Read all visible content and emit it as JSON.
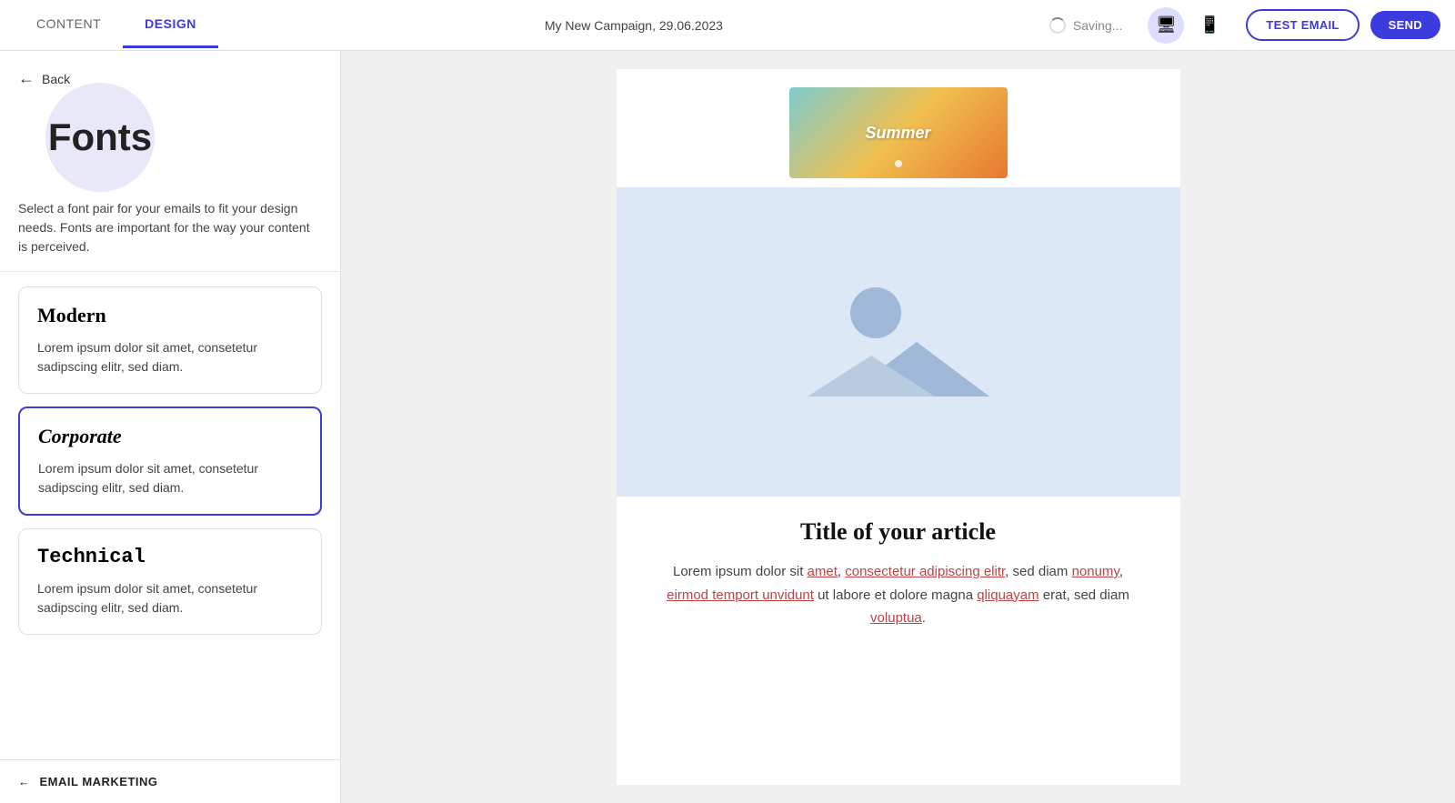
{
  "topbar": {
    "tab_content": "CONTENT",
    "tab_design": "DESIGN",
    "campaign_name": "My New Campaign, 29.06.2023",
    "saving_text": "Saving...",
    "test_email_label": "TEST EMAIL",
    "send_label": "SEND"
  },
  "sidebar": {
    "back_label": "Back",
    "title": "Fonts",
    "description": "Select a font pair for your emails to fit your design needs. Fonts are important for the way your content is perceived.",
    "font_cards": [
      {
        "id": "modern",
        "title": "Modern",
        "title_class": "modern",
        "body": "Lorem ipsum dolor sit amet, consetetur sadipscing elitr, sed diam.",
        "selected": false
      },
      {
        "id": "corporate",
        "title": "Corporate",
        "title_class": "corporate",
        "body": "Lorem ipsum dolor sit amet, consetetur sadipscing elitr, sed diam.",
        "selected": true
      },
      {
        "id": "technical",
        "title": "Technical",
        "title_class": "technical",
        "body": "Lorem ipsum dolor sit amet, consetetur sadipscing elitr, sed diam.",
        "selected": false
      }
    ],
    "bottom_label": "EMAIL MARKETING"
  },
  "preview": {
    "summer_label": "Summer",
    "article_title": "Title of your article",
    "article_body_1": "Lorem ipsum dolor sit amet, ",
    "article_body_link1": "amet",
    "article_body_2": ", consectetur adipiscing elitr, sed diam ",
    "article_body_link2": "nonumy",
    "article_body_3": ", ",
    "article_body_link3": "eirmod temport unvidunt",
    "article_body_4": " ut labore et dolore magna ",
    "article_body_link4": "qliquayam",
    "article_body_5": " erat, sed diam ",
    "article_body_link5": "voluptua",
    "article_body_6": "."
  }
}
